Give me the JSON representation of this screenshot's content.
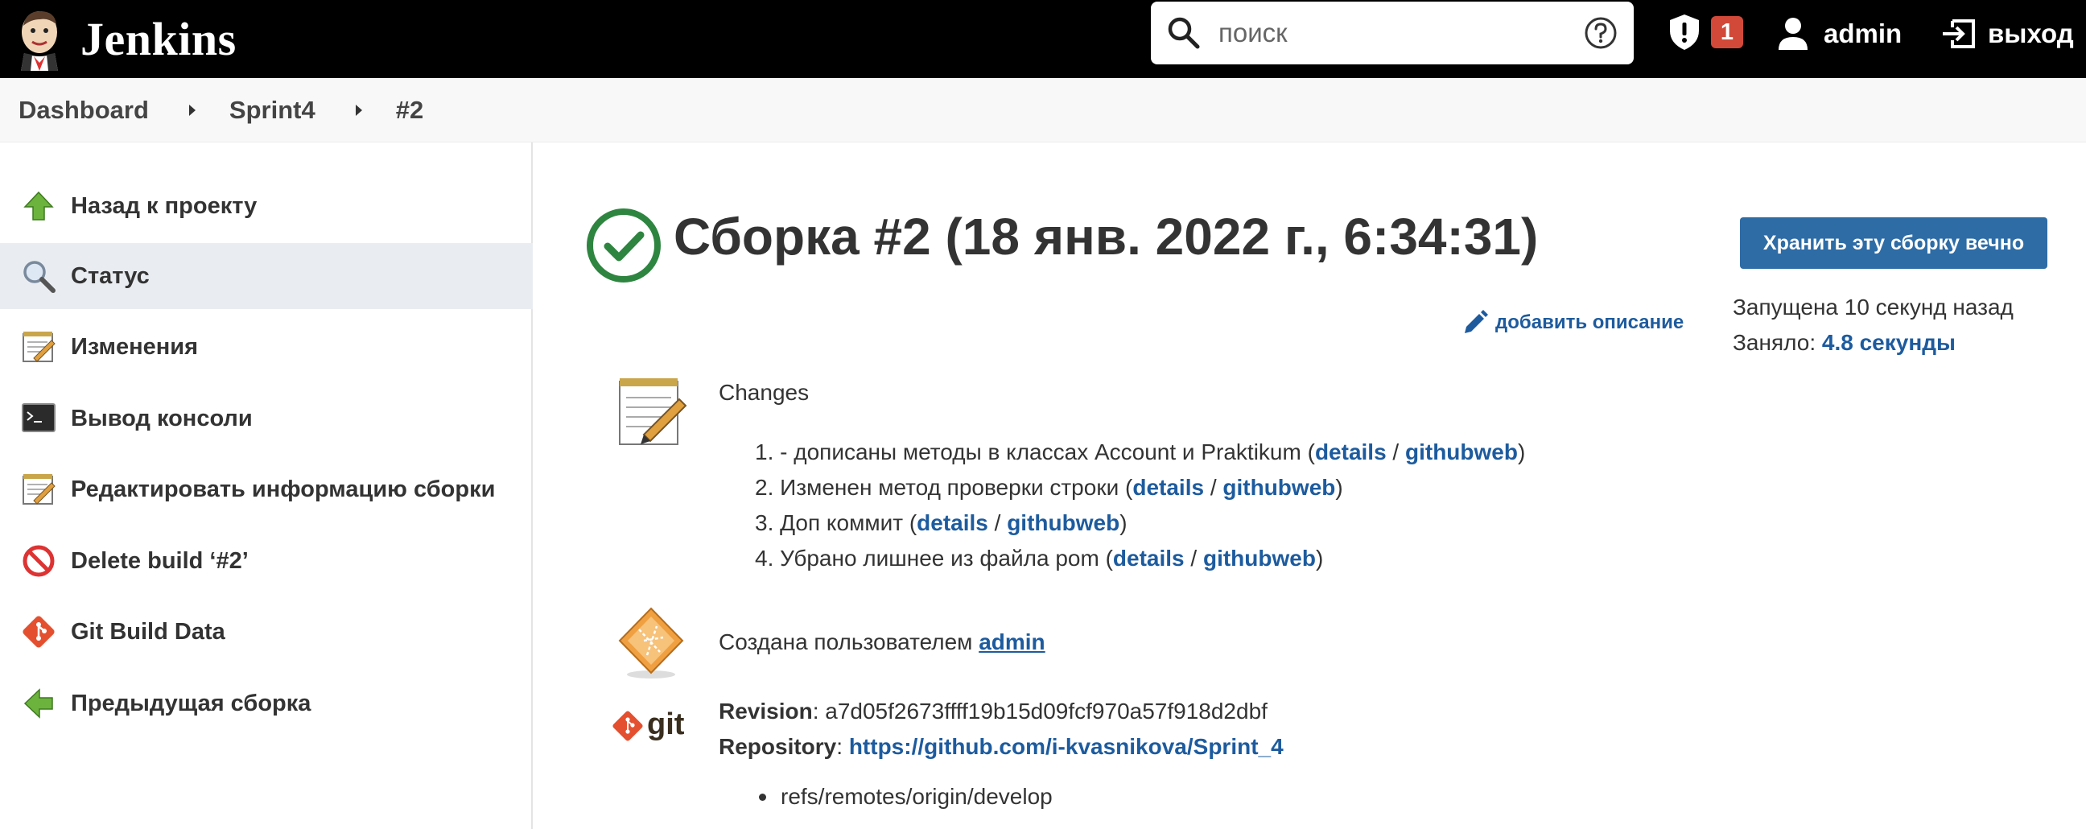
{
  "header": {
    "logo_text": "Jenkins",
    "search_placeholder": "поиск",
    "alert_count": "1",
    "user_name": "admin",
    "logout_label": "выход"
  },
  "breadcrumb": [
    "Dashboard",
    "Sprint4",
    "#2"
  ],
  "sidebar": {
    "items": [
      {
        "label": "Назад к проекту",
        "icon": "up-arrow-icon"
      },
      {
        "label": "Статус",
        "icon": "magnifier-icon"
      },
      {
        "label": "Изменения",
        "icon": "notepad-icon"
      },
      {
        "label": "Вывод консоли",
        "icon": "terminal-icon"
      },
      {
        "label": "Редактировать информацию сборки",
        "icon": "notepad-icon"
      },
      {
        "label": "Delete build ‘#2’",
        "icon": "no-entry-icon"
      },
      {
        "label": "Git Build Data",
        "icon": "git-icon"
      },
      {
        "label": "Предыдущая сборка",
        "icon": "left-arrow-icon"
      }
    ],
    "active_index": 1
  },
  "build": {
    "title": "Сборка #2 (18 янв. 2022 г., 6:34:31)",
    "status_color": "#2e8540",
    "keep_button_label": "Хранить эту сборку вечно",
    "started_text": "Запущена 10 секунд назад",
    "took_label": "Заняло:",
    "took_value": "4.8 секунды",
    "add_description_label": "добавить описание"
  },
  "changes": {
    "title": "Changes",
    "items": [
      {
        "num": "1.",
        "text": "- дописаны методы в классах Account и Praktikum",
        "details": "details",
        "githubweb": "githubweb"
      },
      {
        "num": "2.",
        "text": "Изменен метод проверки строки",
        "details": "details",
        "githubweb": "githubweb"
      },
      {
        "num": "3.",
        "text": "Доп коммит",
        "details": "details",
        "githubweb": "githubweb"
      },
      {
        "num": "4.",
        "text": "Убрано лишнее из файла pom",
        "details": "details",
        "githubweb": "githubweb"
      }
    ]
  },
  "cause": {
    "prefix": "Создана пользователем",
    "user": "admin"
  },
  "git": {
    "logo_text": "git",
    "revision_label": "Revision",
    "revision_value": "a7d05f2673ffff19b15d09fcf970a57f918d2dbf",
    "repository_label": "Repository",
    "repository_url": "https://github.com/i-kvasnikova/Sprint_4",
    "branches": [
      "refs/remotes/origin/develop"
    ]
  }
}
